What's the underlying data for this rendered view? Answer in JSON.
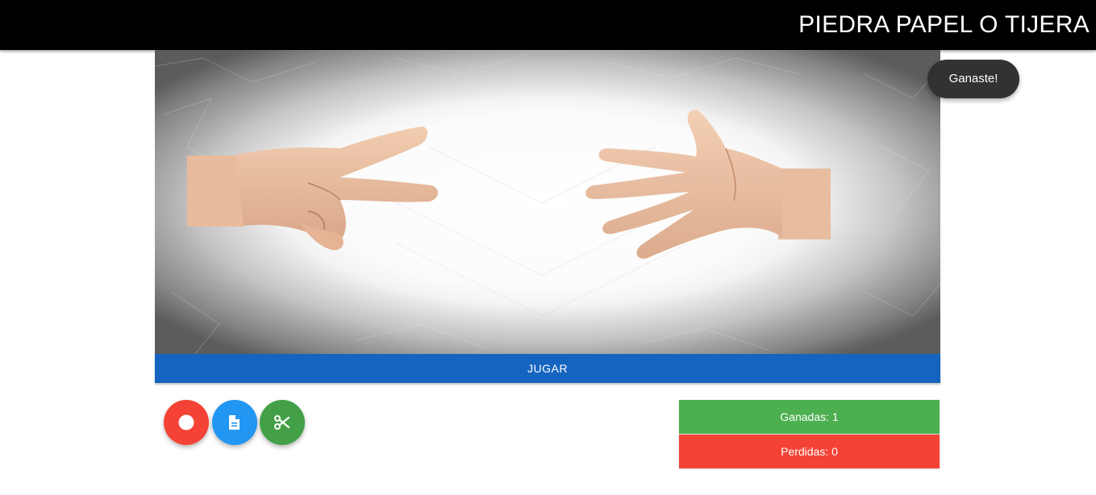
{
  "header": {
    "title": "PIEDRA PAPEL O TIJERA"
  },
  "game": {
    "player_hand": "scissors",
    "computer_hand": "paper",
    "play_label": "JUGAR",
    "choices": [
      {
        "name": "piedra",
        "icon": "record-circle-icon",
        "color": "#f44336"
      },
      {
        "name": "papel",
        "icon": "document-icon",
        "color": "#2196f3"
      },
      {
        "name": "tijera",
        "icon": "scissors-icon",
        "color": "#43a047"
      }
    ]
  },
  "score": {
    "won_label": "Ganadas: 1",
    "lost_label": "Perdidas: 0",
    "won_color": "#4caf50",
    "lost_color": "#f44336"
  },
  "toast": {
    "message": "Ganaste!"
  },
  "colors": {
    "navbar": "#000000",
    "play_button": "#1565c0"
  }
}
